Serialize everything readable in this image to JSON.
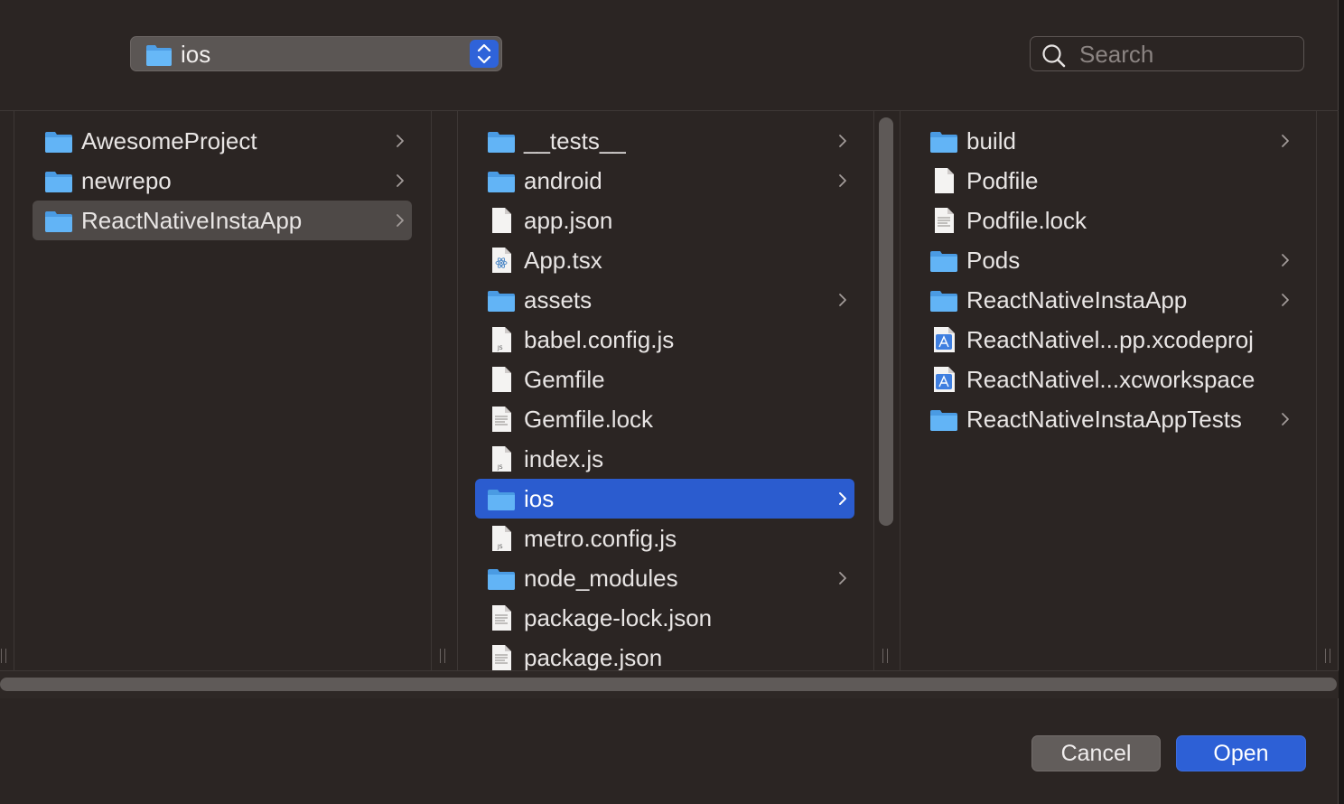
{
  "toolbar": {
    "path_label": "ios",
    "search_placeholder": "Search"
  },
  "columns": [
    {
      "items": [
        {
          "name": "AwesomeProject",
          "type": "folder",
          "has_children": true,
          "selected": ""
        },
        {
          "name": "newrepo",
          "type": "folder",
          "has_children": true,
          "selected": ""
        },
        {
          "name": "ReactNativeInstaApp",
          "type": "folder",
          "has_children": true,
          "selected": "inactive"
        }
      ]
    },
    {
      "items": [
        {
          "name": "__tests__",
          "type": "folder",
          "has_children": true,
          "selected": ""
        },
        {
          "name": "android",
          "type": "folder",
          "has_children": true,
          "selected": ""
        },
        {
          "name": "app.json",
          "type": "file",
          "has_children": false,
          "selected": ""
        },
        {
          "name": "App.tsx",
          "type": "react",
          "has_children": false,
          "selected": ""
        },
        {
          "name": "assets",
          "type": "folder",
          "has_children": true,
          "selected": ""
        },
        {
          "name": "babel.config.js",
          "type": "js",
          "has_children": false,
          "selected": ""
        },
        {
          "name": "Gemfile",
          "type": "file",
          "has_children": false,
          "selected": ""
        },
        {
          "name": "Gemfile.lock",
          "type": "text",
          "has_children": false,
          "selected": ""
        },
        {
          "name": "index.js",
          "type": "js",
          "has_children": false,
          "selected": ""
        },
        {
          "name": "ios",
          "type": "folder",
          "has_children": true,
          "selected": "active"
        },
        {
          "name": "metro.config.js",
          "type": "js",
          "has_children": false,
          "selected": ""
        },
        {
          "name": "node_modules",
          "type": "folder",
          "has_children": true,
          "selected": ""
        },
        {
          "name": "package-lock.json",
          "type": "text",
          "has_children": false,
          "selected": ""
        },
        {
          "name": "package.json",
          "type": "text",
          "has_children": false,
          "selected": ""
        }
      ]
    },
    {
      "items": [
        {
          "name": "build",
          "type": "folder",
          "has_children": true,
          "selected": ""
        },
        {
          "name": "Podfile",
          "type": "file",
          "has_children": false,
          "selected": ""
        },
        {
          "name": "Podfile.lock",
          "type": "text",
          "has_children": false,
          "selected": ""
        },
        {
          "name": "Pods",
          "type": "folder",
          "has_children": true,
          "selected": ""
        },
        {
          "name": "ReactNativeInstaApp",
          "type": "folder",
          "has_children": true,
          "selected": ""
        },
        {
          "name": "ReactNativel...pp.xcodeproj",
          "type": "xcode",
          "has_children": false,
          "selected": ""
        },
        {
          "name": "ReactNativel...xcworkspace",
          "type": "xcode",
          "has_children": false,
          "selected": ""
        },
        {
          "name": "ReactNativeInstaAppTests",
          "type": "folder",
          "has_children": true,
          "selected": ""
        }
      ]
    }
  ],
  "buttons": {
    "cancel": "Cancel",
    "open": "Open"
  },
  "colors": {
    "background": "#2b2523",
    "accent_blue": "#2b5ccf",
    "folder_blue": "#5fb2f5"
  }
}
